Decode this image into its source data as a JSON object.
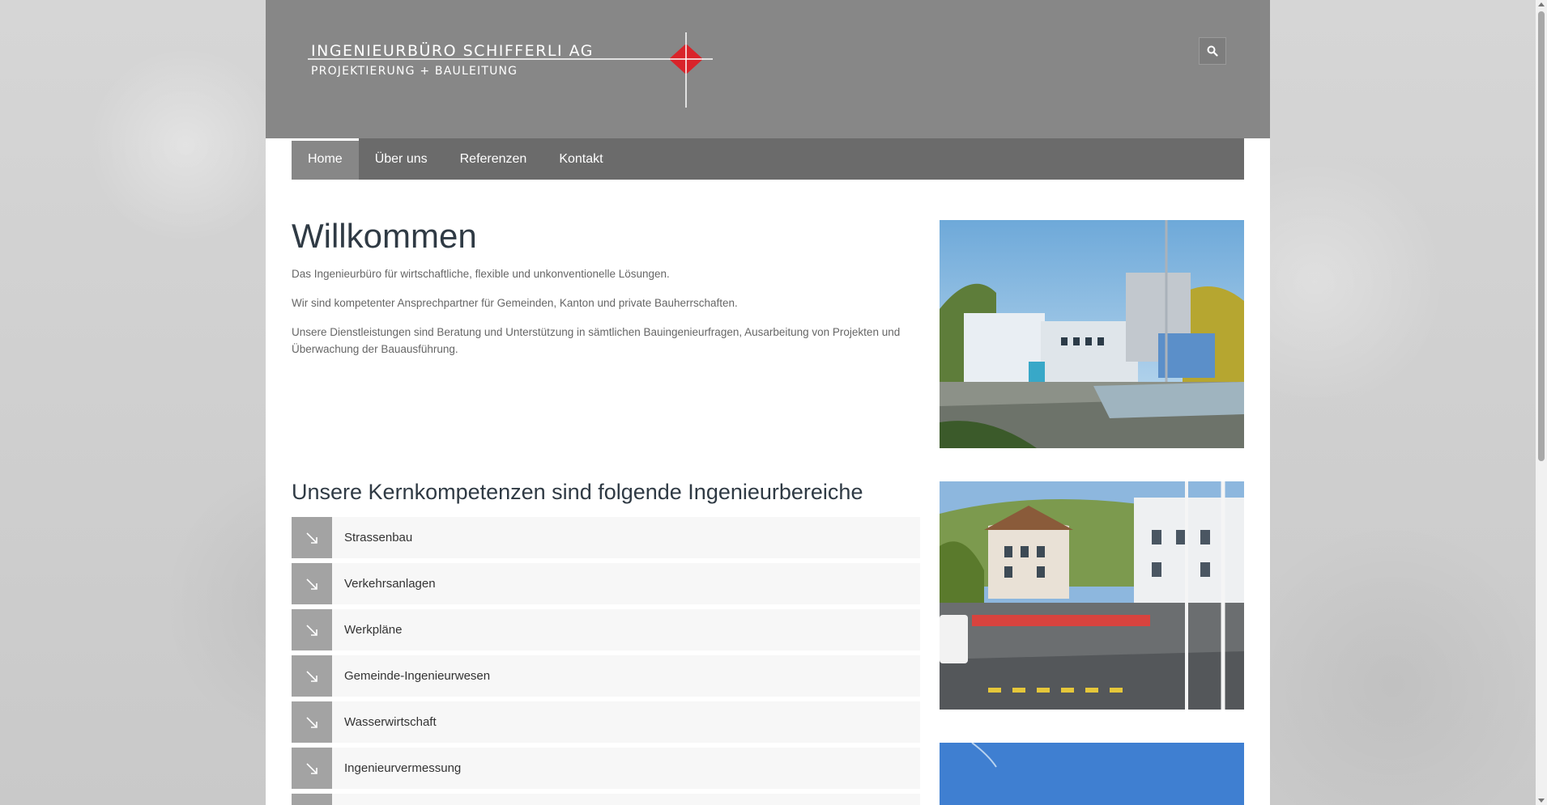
{
  "header": {
    "logo_line1": "INGENIEURBÜRO SCHIFFERLI AG",
    "logo_line2": "PROJEKTIERUNG + BAULEITUNG",
    "logo_accent_color": "#d9232a"
  },
  "nav": {
    "items": [
      {
        "label": "Home",
        "active": true
      },
      {
        "label": "Über uns"
      },
      {
        "label": "Referenzen"
      },
      {
        "label": "Kontakt"
      }
    ]
  },
  "main": {
    "title": "Willkommen",
    "paragraphs": [
      "Das Ingenieurbüro für wirtschaftliche, flexible und unkonventionelle Lösungen.",
      "Wir sind kompetenter Ansprechpartner für Gemeinden, Kanton und private Bauherrschaften.",
      "Unsere Dienstleistungen sind Beratung und Unterstützung in sämtlichen Bauingenieurfragen, Ausarbeitung von Projekten und Überwachung der Bauausführung."
    ],
    "competences_title": "Unsere Kernkompetenzen sind folgende Ingenieurbereiche",
    "competences": [
      "Strassenbau",
      "Verkehrsanlagen",
      "Werkpläne",
      "Gemeinde-Ingenieurwesen",
      "Wasserwirtschaft",
      "Ingenieurvermessung"
    ]
  },
  "colors": {
    "header_bg": "#878787",
    "nav_bg": "#6b6b6b",
    "title_color": "#2f3a44"
  }
}
